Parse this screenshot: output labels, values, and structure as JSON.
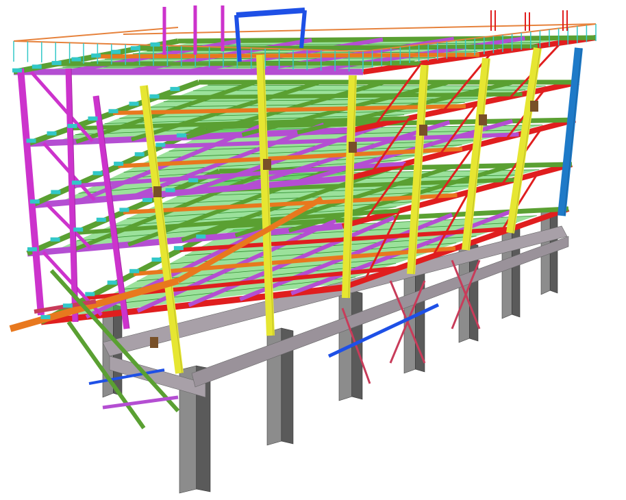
{
  "image": {
    "subject": "steel-structure-3d-model",
    "background": "#ffffff"
  },
  "palette": {
    "concrete": "#8c8c8c",
    "concrete_dark": "#5a5a5a",
    "concrete_beam": "#a8a0a8",
    "column_yellow": "#e6e632",
    "brace_magenta": "#cc33cc",
    "bracing_purple": "#b44ed2",
    "beam_green": "#5aa032",
    "deck_green": "#48c848",
    "beam_red": "#e01e1e",
    "beam_orange": "#e8781e",
    "beam_blue": "#1e50e6",
    "beam_cyan": "#2aa0c8",
    "column_blue": "#1e7ac8",
    "rail_orange": "#e6823c",
    "rail_cyan": "#32c8c8",
    "plate_brown": "#785028"
  }
}
